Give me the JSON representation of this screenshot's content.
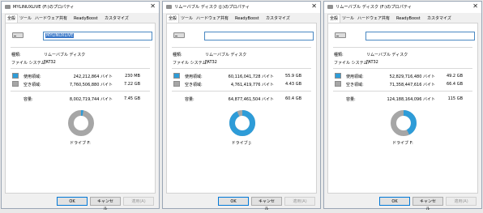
{
  "tabs": [
    "全般",
    "ツール",
    "ハードウェア",
    "共有",
    "ReadyBoost",
    "カスタマイズ"
  ],
  "labels": {
    "type": "種類:",
    "filesystem": "ファイル システム:",
    "used": "使用領域:",
    "free": "空き領域:",
    "capacity": "容量:"
  },
  "buttons": {
    "ok": "OK",
    "cancel": "キャンセル",
    "apply": "適用(A)"
  },
  "colors": {
    "used": "#2e9cd8",
    "free": "#a6a6a6"
  },
  "dialogs": [
    {
      "title": "MYLINUXLIVE (F:)のプロパティ",
      "name_value": "MYLINUXLIVE",
      "type_value": "リムーバブル ディスク",
      "fs_value": "FAT32",
      "used_bytes": "242,212,864 バイト",
      "used_size": "230 MB",
      "free_bytes": "7,760,506,880 バイト",
      "free_size": "7.22 GB",
      "cap_bytes": "8,002,719,744 バイト",
      "cap_size": "7.45 GB",
      "drive_label": "ドライブ F:",
      "used_fraction": 0.03
    },
    {
      "title": "リムーバブル ディスク (J:)のプロパティ",
      "name_value": "",
      "type_value": "リムーバブル ディスク",
      "fs_value": "FAT32",
      "used_bytes": "60,116,041,728 バイト",
      "used_size": "55.9 GB",
      "free_bytes": "4,761,419,776 バイト",
      "free_size": "4.43 GB",
      "cap_bytes": "64,877,461,504 バイト",
      "cap_size": "60.4 GB",
      "drive_label": "ドライブ J:",
      "used_fraction": 0.927
    },
    {
      "title": "リムーバブル ディスク (F:)のプロパティ",
      "name_value": "",
      "type_value": "リムーバブル ディスク",
      "fs_value": "FAT32",
      "used_bytes": "52,829,716,480 バイト",
      "used_size": "49.2 GB",
      "free_bytes": "71,358,447,616 バイト",
      "free_size": "66.4 GB",
      "cap_bytes": "124,188,164,096 バイト",
      "cap_size": "115 GB",
      "drive_label": "ドライブ F:",
      "used_fraction": 0.425
    }
  ]
}
